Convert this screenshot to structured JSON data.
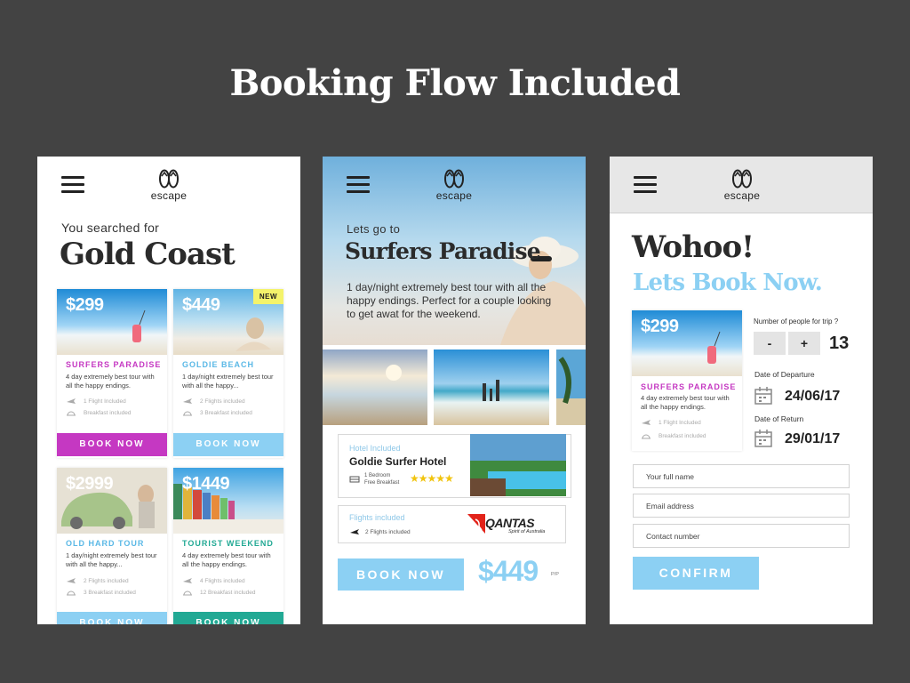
{
  "headline": "Booking Flow Included",
  "brand": {
    "logo_word": "escape"
  },
  "screen1": {
    "searched_label": "You searched for",
    "city": "Gold Coast",
    "cards": [
      {
        "price": "$299",
        "title": "SURFERS PARADISE",
        "desc": "4 day extremely best tour with all the happy endings.",
        "feature1": "1 Flight Included",
        "feature2": "Breakfast included",
        "button": "BOOK NOW",
        "accent": "#c538c2",
        "button_color": "#c538c2"
      },
      {
        "price": "$449",
        "badge": "NEW",
        "title": "GOLDIE BEACH",
        "desc": "1 day/night extremely best tour with all the happy...",
        "feature1": "2 Flights included",
        "feature2": "3 Breakfast included",
        "button": "BOOK NOW",
        "accent": "#5ab8e6",
        "button_color": "#8cd0f3"
      },
      {
        "price": "$2999",
        "title": "OLD HARD TOUR",
        "desc": "1 day/night extremely best tour with all the happy...",
        "feature1": "2 Flights included",
        "feature2": "3 Breakfast included",
        "button": "BOOK NOW",
        "accent": "#5ab8e6",
        "button_color": "#8cd0f3"
      },
      {
        "price": "$1449",
        "title": "TOURIST WEEKEND",
        "desc": "4 day extremely best tour with all the happy endings.",
        "feature1": "4 Flights included",
        "feature2": "12 Breakfast included",
        "button": "BOOK NOW",
        "accent": "#22a994",
        "button_color": "#22a994"
      }
    ]
  },
  "screen2": {
    "lets_go": "Lets go to",
    "destination": "Surfers Paradise",
    "description": "1 day/night extremely best tour with all the happy endings. Perfect for a couple looking to get awat for the weekend.",
    "hotel": {
      "label": "Hotel Included",
      "name": "Goldie Surfer Hotel",
      "bed": "1 Bedroom",
      "breakfast": "Free Breakfast",
      "stars": "★★★★★"
    },
    "flight": {
      "label": "Flights included",
      "info": "2 Flights included",
      "airline": "QANTAS",
      "airline_tagline": "Spirit of Australia"
    },
    "book_button": "BOOK NOW",
    "price": "$449",
    "per_person": "P/P"
  },
  "screen3": {
    "title": "Wohoo!",
    "subtitle": "Lets Book Now.",
    "card": {
      "price": "$299",
      "title": "SURFERS PARADISE",
      "desc": "4 day extremely best tour with all the happy endings.",
      "feature1": "1 Flight Included",
      "feature2": "Breakfast included"
    },
    "people_label": "Number of people for trip ?",
    "minus": "-",
    "plus": "+",
    "people_count": "13",
    "departure_label": "Date of Departure",
    "departure_date": "24/06/17",
    "return_label": "Date of Return",
    "return_date": "29/01/17",
    "fields": {
      "name": "Your full name",
      "email": "Email address",
      "contact": "Contact number"
    },
    "confirm": "CONFIRM"
  }
}
